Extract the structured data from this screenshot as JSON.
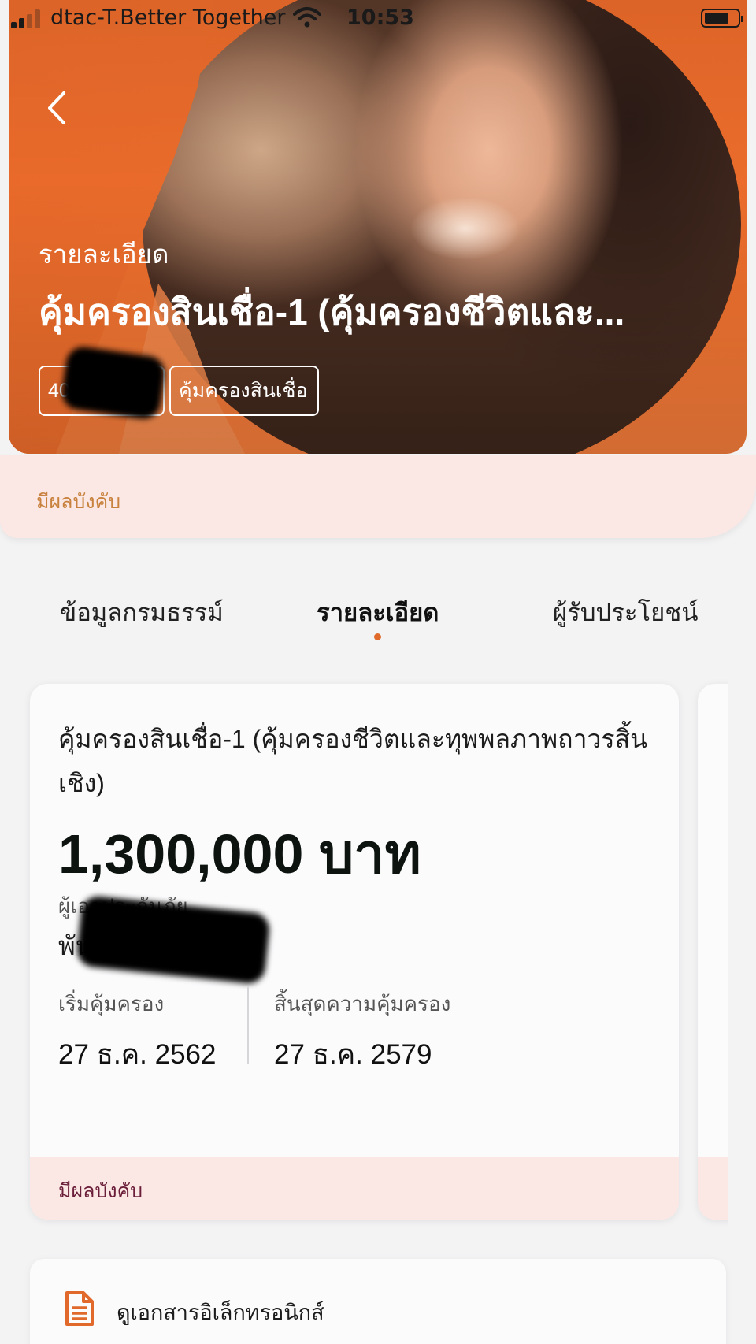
{
  "status_bar": {
    "carrier": "dtac-T.Better Together",
    "time": "10:53",
    "signal_bars_active": 2,
    "signal_bars_total": 4
  },
  "hero": {
    "subtitle": "รายละเอียด",
    "title": "คุ้มครองสินเชื่อ-1 (คุ้มครองชีวิตและ...",
    "policy_number": "40686",
    "policy_type_chip": "คุ้มครองสินเชื่อ",
    "status": "มีผลบังคับ",
    "accent_color": "#e8692a",
    "status_bg_color": "#fbe7e3"
  },
  "tabs": [
    {
      "label": "ข้อมูลกรมธรรม์",
      "active": false
    },
    {
      "label": "รายละเอียด",
      "active": true
    },
    {
      "label": "ผู้รับประโยชน์",
      "active": false
    }
  ],
  "coverage_card": {
    "name": "คุ้มครองสินเชื่อ-1 (คุ้มครองชีวิตและทุพพลภาพถาวรสิ้นเชิง)",
    "amount": "1,300,000 บาท",
    "insured_label": "ผู้เอาประกันภัย",
    "insured_name": "พันหาญ    ร์",
    "start_label": "เริ่มคุ้มครอง",
    "start_date": "27 ธ.ค. 2562",
    "end_label": "สิ้นสุดความคุ้มครอง",
    "end_date": "27 ธ.ค. 2579",
    "status": "มีผลบังคับ"
  },
  "e_document": {
    "label": "ดูเอกสารอิเล็กทรอนิกส์",
    "icon": "document-icon"
  }
}
